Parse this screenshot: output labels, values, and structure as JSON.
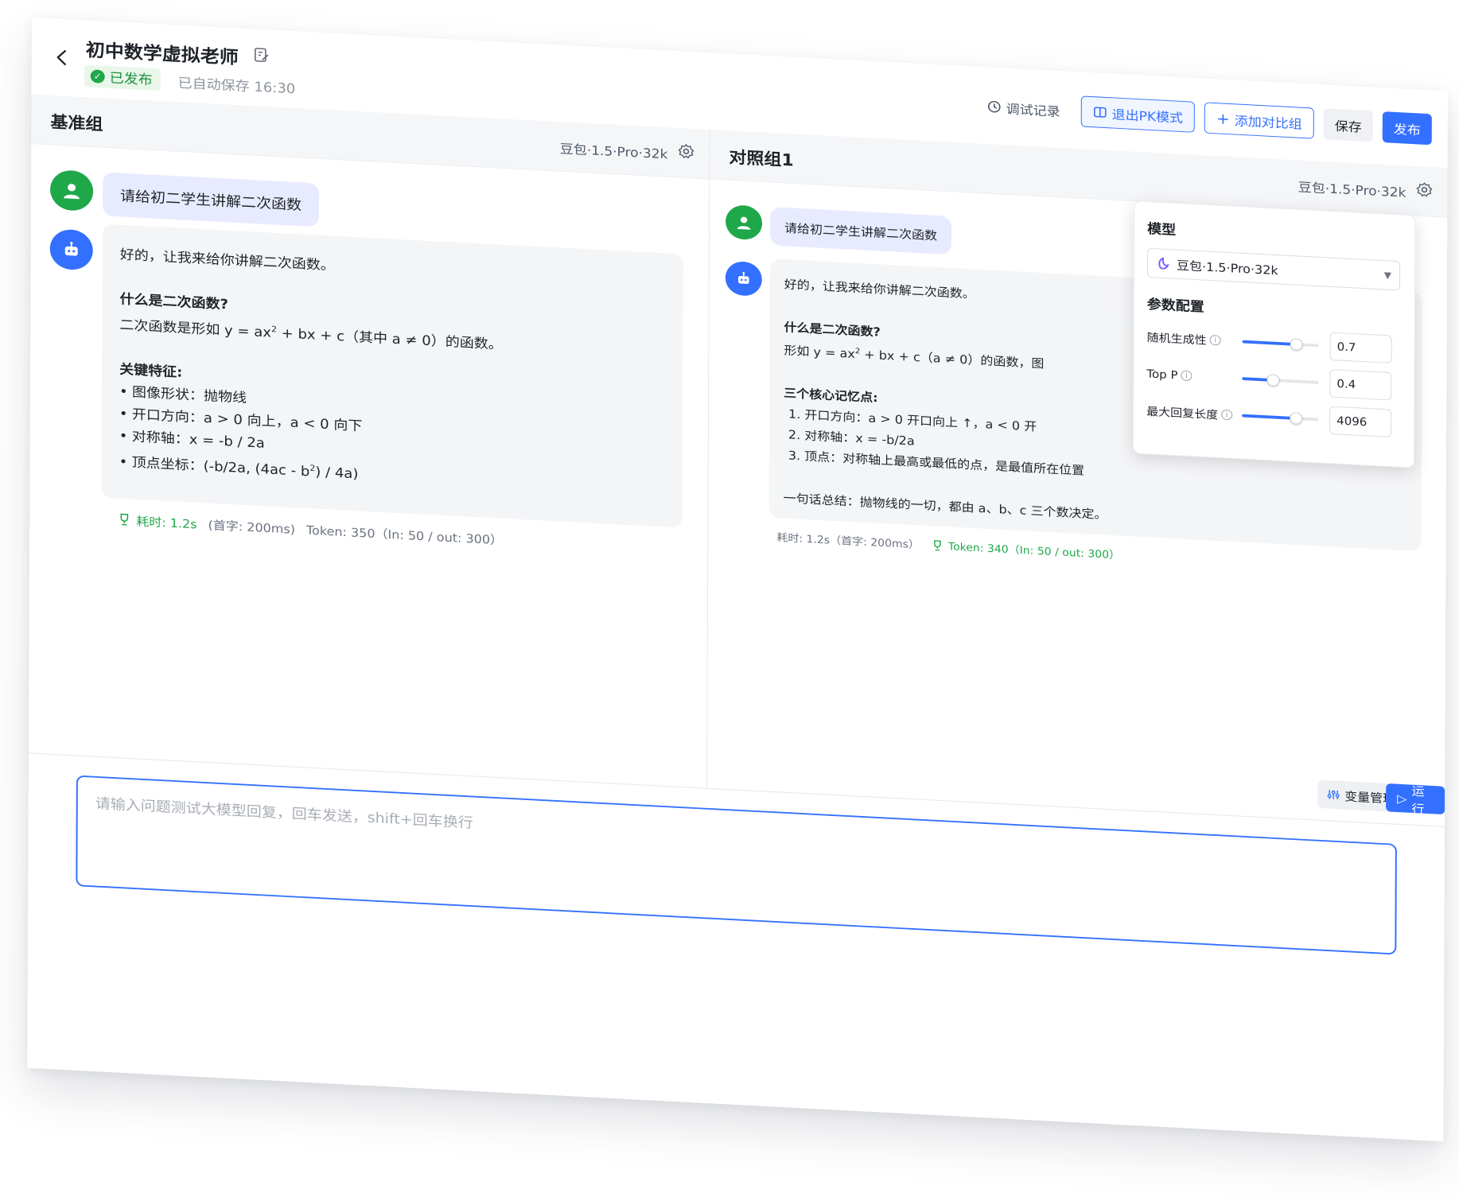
{
  "header": {
    "title": "初中数学虚拟老师",
    "status": "已发布",
    "autosave": "已自动保存 16:30",
    "debug_log": "调试记录",
    "exit_pk": "退出PK模式",
    "add_group": "添加对比组",
    "save": "保存",
    "publish": "发布"
  },
  "colors": {
    "accent": "#3370ff",
    "success": "#1fa84a"
  },
  "base_group": {
    "title": "基准组",
    "model": "豆包·1.5·Pro·32k",
    "user_msg": "请给初二学生讲解二次函数",
    "reply": {
      "intro": "好的，让我来给你讲解二次函数。",
      "q_title": "什么是二次函数?",
      "q_body_pre": "二次函数是形如 y = ax",
      "sup2": "2",
      "q_body_post": " + bx + c（其中 a ≠ 0）的函数。",
      "features_title": "关键特征:",
      "b1": "图像形状：抛物线",
      "b2": "开口方向：a > 0 向上，a < 0 向下",
      "b3": "对称轴：x = -b / 2a",
      "b4_pre": "顶点坐标：(-b/2a, (4ac - b",
      "b4_post": ") / 4a)"
    },
    "meta": {
      "time": "耗时: 1.2s",
      "first": "(首字: 200ms)",
      "token": "Token: 350（In: 50 / out: 300）"
    }
  },
  "compare_group": {
    "title": "对照组1",
    "model": "豆包·1.5·Pro·32k",
    "user_msg": "请给初二学生讲解二次函数",
    "reply": {
      "intro": "好的，让我来给你讲解二次函数。",
      "q_title": "什么是二次函数?",
      "q_body_pre": "形如 y = ax",
      "sup2": "2",
      "q_body_post": " + bx + c（a ≠ 0）的函数，图",
      "points_title": "三个核心记忆点:",
      "p1": "1. 开口方向：a > 0 开口向上 ↑，a < 0 开",
      "p2": "2. 对称轴：x = -b/2a",
      "p3": "3. 顶点：对称轴上最高或最低的点，是最值所在位置",
      "summary": "一句话总结：抛物线的一切，都由 a、b、c 三个数决定。"
    },
    "meta": {
      "time": "耗时: 1.2s（首字: 200ms）",
      "token": "Token: 340（In: 50 / out: 300）"
    }
  },
  "popover": {
    "model_label": "模型",
    "model_value": "豆包·1.5·Pro·32k",
    "params_label": "参数配置",
    "params": [
      {
        "name": "随机生成性",
        "value": "0.7",
        "level": 0.7
      },
      {
        "name": "Top P",
        "value": "0.4",
        "level": 0.4
      },
      {
        "name": "最大回复长度",
        "value": "4096",
        "level": 0.7
      }
    ]
  },
  "composer": {
    "placeholder": "请输入问题测试大模型回复，回车发送，shift+回车换行",
    "var_btn": "变量管理",
    "run_btn": "运行"
  }
}
